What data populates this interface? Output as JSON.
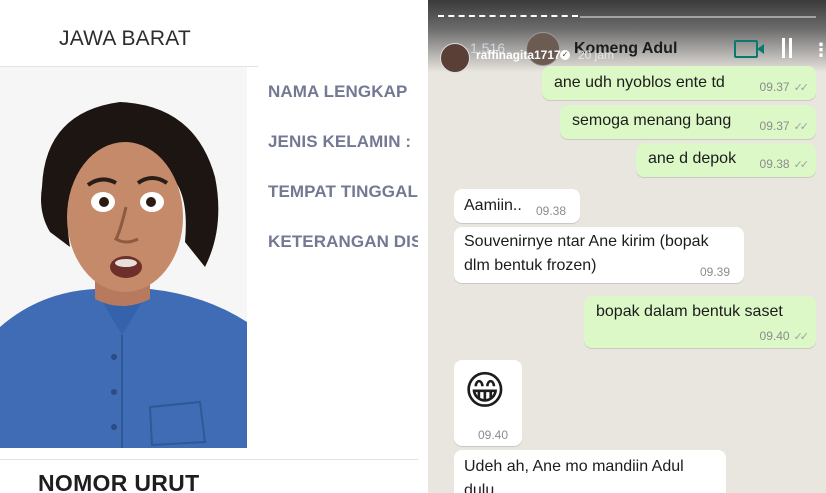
{
  "profile": {
    "region": "JAWA BARAT",
    "fields": [
      "NAMA LENGKAP",
      "JENIS KELAMIN :",
      "TEMPAT TINGGAL",
      "KETERANGAN DISABILITAS"
    ],
    "footer": "NOMOR URUT"
  },
  "story": {
    "username": "raffinagita1717",
    "time": "20 jam",
    "count": "1.516"
  },
  "chat": {
    "contact": "Komeng Adul",
    "messages": [
      {
        "dir": "out",
        "text": "ane udh nyoblos ente td",
        "time": "09.37",
        "ticks": "✓✓"
      },
      {
        "dir": "out",
        "text": "semoga menang bang",
        "time": "09.37",
        "ticks": "✓✓"
      },
      {
        "dir": "out",
        "text": "ane d depok",
        "time": "09.38",
        "ticks": "✓✓"
      },
      {
        "dir": "in",
        "text": "Aamiin..",
        "time": "09.38"
      },
      {
        "dir": "in",
        "line1": "Souvenirnye ntar Ane kirim (bopak",
        "line2": "dlm bentuk frozen)",
        "time": "09.39"
      },
      {
        "dir": "out",
        "text": "bopak dalam bentuk saset",
        "time": "09.40",
        "ticks": "✓✓"
      },
      {
        "dir": "in",
        "emoji": "😁",
        "time": "09.40"
      },
      {
        "dir": "in",
        "text": "Udeh ah, Ane mo mandiin Adul",
        "line2": "dulu"
      }
    ]
  }
}
